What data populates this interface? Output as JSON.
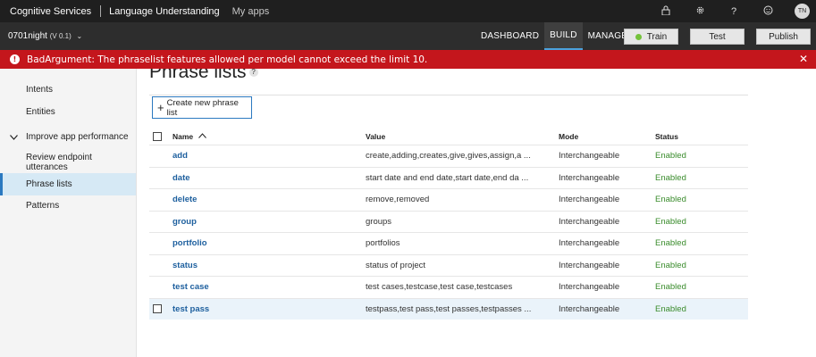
{
  "topbar": {
    "brand": "Cognitive Services",
    "app": "Language Understanding",
    "my_apps": "My apps",
    "icons": [
      "lock-icon",
      "gear-icon",
      "help-icon",
      "smiley-icon"
    ],
    "user_initials": "TN"
  },
  "appbar": {
    "app_name": "0701night",
    "version": "(V 0.1)",
    "nav": [
      "DASHBOARD",
      "BUILD",
      "MANAGE"
    ],
    "active_nav": "BUILD",
    "train_label": "Train",
    "test_label": "Test",
    "publish_label": "Publish"
  },
  "error": {
    "message": "BadArgument: The phraselist features allowed per model cannot exceed the limit 10."
  },
  "sidebar": {
    "items": [
      "Intents",
      "Entities",
      "Improve app performance",
      "Review endpoint utterances",
      "Phrase lists",
      "Patterns"
    ],
    "active": "Phrase lists"
  },
  "main": {
    "title": "Phrase lists",
    "help": "?",
    "create_label": "Create new phrase list",
    "columns": {
      "name": "Name",
      "value": "Value",
      "mode": "Mode",
      "status": "Status"
    },
    "rows": [
      {
        "name": "add",
        "value": "create,adding,creates,give,gives,assign,a ...",
        "mode": "Interchangeable",
        "status": "Enabled"
      },
      {
        "name": "date",
        "value": "start date and end date,start date,end da ...",
        "mode": "Interchangeable",
        "status": "Enabled"
      },
      {
        "name": "delete",
        "value": "remove,removed",
        "mode": "Interchangeable",
        "status": "Enabled"
      },
      {
        "name": "group",
        "value": "groups",
        "mode": "Interchangeable",
        "status": "Enabled"
      },
      {
        "name": "portfolio",
        "value": "portfolios",
        "mode": "Interchangeable",
        "status": "Enabled"
      },
      {
        "name": "status",
        "value": "status of project",
        "mode": "Interchangeable",
        "status": "Enabled"
      },
      {
        "name": "test case",
        "value": "test cases,testcase,test case,testcases",
        "mode": "Interchangeable",
        "status": "Enabled"
      },
      {
        "name": "test pass",
        "value": "testpass,test pass,test passes,testpasses ...",
        "mode": "Interchangeable",
        "status": "Enabled"
      }
    ]
  },
  "colors": {
    "error_bg": "#c4161c",
    "accent": "#2b79c0",
    "status_enabled": "#3a8c2c",
    "train_dot": "#74c23b"
  }
}
